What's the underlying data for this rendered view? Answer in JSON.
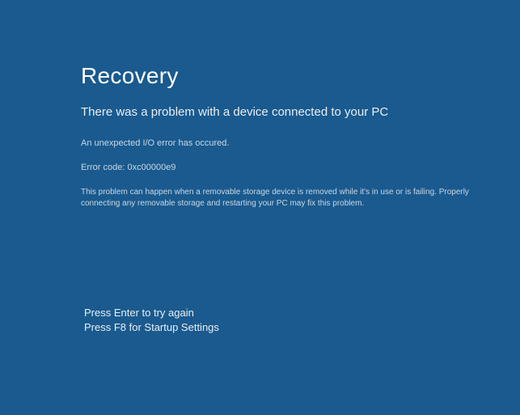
{
  "title": "Recovery",
  "subtitle": "There was a problem with a device connected to your PC",
  "message": "An unexpected I/O error has occured.",
  "error_label": "Error code:",
  "error_code": "0xc00000e9",
  "description": "This problem can happen when a removable storage device is removed while it's in use or is failing. Properly connecting any removable storage and restarting your PC may fix this problem.",
  "actions": {
    "retry": "Press Enter to try again",
    "startup": "Press F8 for Startup Settings"
  }
}
